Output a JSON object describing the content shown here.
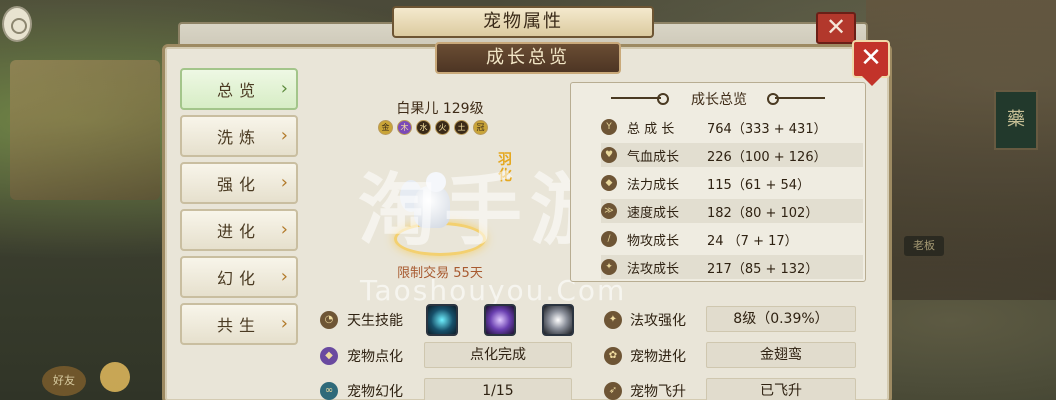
{
  "background": {
    "sign_glyph": "藥",
    "boss_label": "老板",
    "friend_label": "好友"
  },
  "back_window": {
    "title": "宠物属性",
    "close_glyph": "✕"
  },
  "panel": {
    "title": "成长总览",
    "close_glyph": "✕"
  },
  "nav": {
    "items": [
      {
        "label": "总览",
        "active": true
      },
      {
        "label": "洗炼",
        "active": false
      },
      {
        "label": "强化",
        "active": false
      },
      {
        "label": "进化",
        "active": false
      },
      {
        "label": "幻化",
        "active": false
      },
      {
        "label": "共生",
        "active": false
      }
    ],
    "chevron": "›"
  },
  "pet": {
    "name_level": "白果儿 129级",
    "elements": [
      "金",
      "木",
      "水",
      "火",
      "土",
      "冠"
    ],
    "feather_badge": "羽化",
    "trade_limit": "限制交易 55天"
  },
  "watermark": {
    "text": "淘手游",
    "url": "Taoshouyou.Com"
  },
  "growth": {
    "title": "成长总览",
    "rows": [
      {
        "icon": "Y",
        "label": "总 成 长",
        "value": "764（333 + 431）"
      },
      {
        "icon": "♥",
        "label": "气血成长",
        "value": "226（100 + 126）"
      },
      {
        "icon": "◆",
        "label": "法力成长",
        "value": "115（61 + 54）"
      },
      {
        "icon": "≫",
        "label": "速度成长",
        "value": "182（80 + 102）"
      },
      {
        "icon": "/",
        "label": "物攻成长",
        "value": "24  （7 + 17）"
      },
      {
        "icon": "✦",
        "label": "法攻成长",
        "value": "217（85 + 132）"
      }
    ]
  },
  "attributes": {
    "innate_skill_label": "天生技能",
    "pet_dot_label": "宠物点化",
    "pet_dot_value": "点化完成",
    "pet_illusion_label": "宠物幻化",
    "pet_illusion_value": "1/15",
    "magic_strengthen_label": "法攻强化",
    "magic_strengthen_value": "8级（0.39%）",
    "pet_evolve_label": "宠物进化",
    "pet_evolve_value": "金翅鸾",
    "pet_fly_label": "宠物飞升",
    "pet_fly_value": "已飞升"
  }
}
